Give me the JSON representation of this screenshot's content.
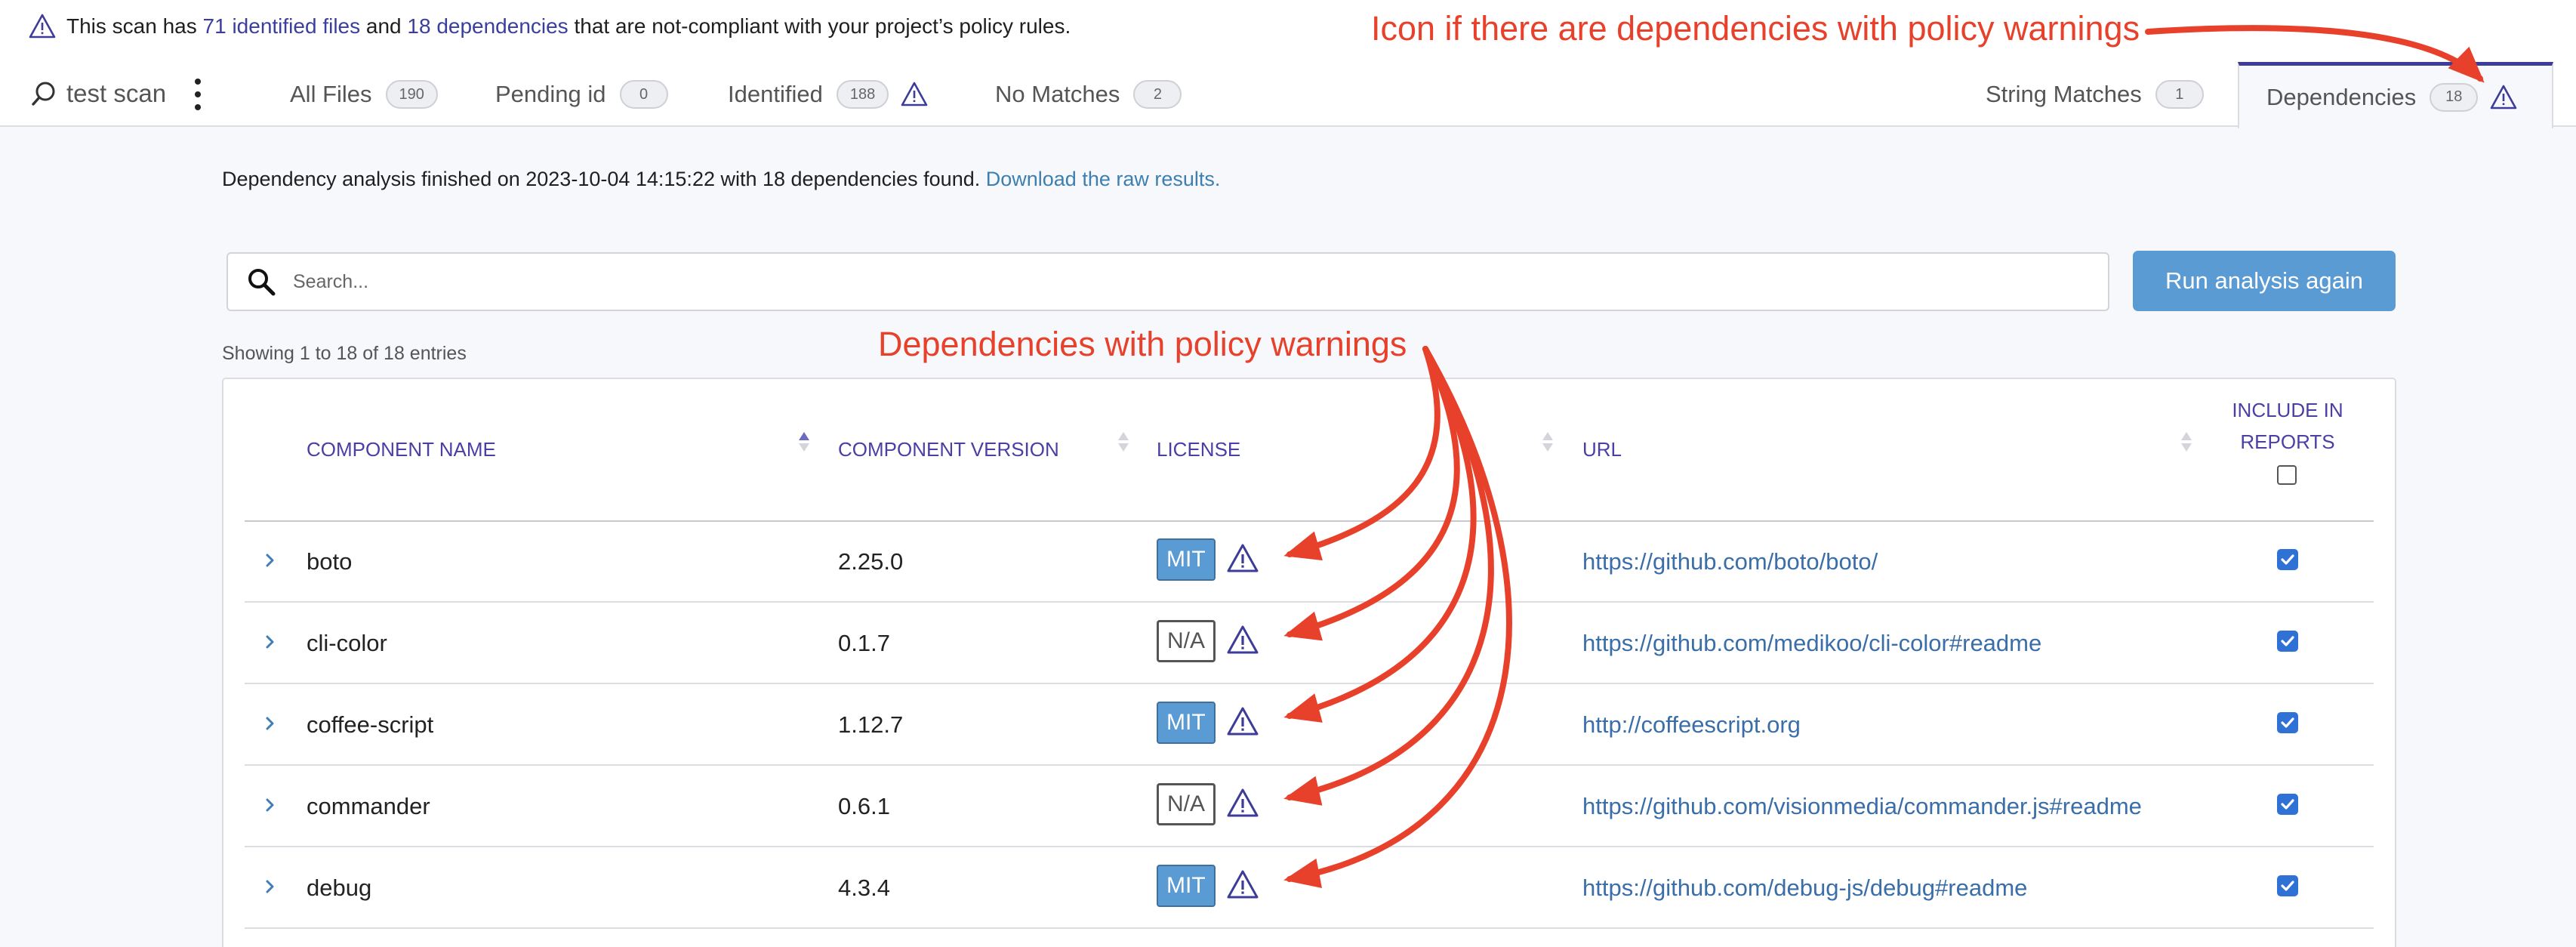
{
  "notice": {
    "prefix": "This scan has",
    "files_link": "71 identified files",
    "middle": "and",
    "deps_link": "18 dependencies",
    "suffix": "that are not-compliant with your project’s policy rules."
  },
  "scan": {
    "name": "test scan"
  },
  "tabs": [
    {
      "label": "All Files",
      "count": "190",
      "warning": false
    },
    {
      "label": "Pending id",
      "count": "0",
      "warning": false
    },
    {
      "label": "Identified",
      "count": "188",
      "warning": true
    },
    {
      "label": "No Matches",
      "count": "2",
      "warning": false
    },
    {
      "label": "String Matches",
      "count": "1",
      "warning": false
    },
    {
      "label": "Dependencies",
      "count": "18",
      "warning": true,
      "active": true
    }
  ],
  "analysis": {
    "text": "Dependency analysis finished on 2023-10-04 14:15:22 with 18 dependencies found.",
    "link": "Download the raw results."
  },
  "search": {
    "placeholder": "Search..."
  },
  "run_button": "Run analysis again",
  "showing": "Showing 1 to 18 of 18 entries",
  "table": {
    "columns": {
      "name": "COMPONENT NAME",
      "version": "COMPONENT VERSION",
      "license": "LICENSE",
      "url": "URL",
      "include_line1": "INCLUDE IN",
      "include_line2": "REPORTS"
    },
    "rows": [
      {
        "name": "boto",
        "version": "2.25.0",
        "license": "MIT",
        "license_style": "mit",
        "policy_warning": true,
        "url": "https://github.com/boto/boto/",
        "included": true
      },
      {
        "name": "cli-color",
        "version": "0.1.7",
        "license": "N/A",
        "license_style": "na",
        "policy_warning": true,
        "url": "https://github.com/medikoo/cli-color#readme",
        "included": true
      },
      {
        "name": "coffee-script",
        "version": "1.12.7",
        "license": "MIT",
        "license_style": "mit",
        "policy_warning": true,
        "url": "http://coffeescript.org",
        "included": true
      },
      {
        "name": "commander",
        "version": "0.6.1",
        "license": "N/A",
        "license_style": "na",
        "policy_warning": true,
        "url": "https://github.com/visionmedia/commander.js#readme",
        "included": true
      },
      {
        "name": "debug",
        "version": "4.3.4",
        "license": "MIT",
        "license_style": "mit",
        "policy_warning": true,
        "url": "https://github.com/debug-js/debug#readme",
        "included": true
      }
    ]
  },
  "annotations": {
    "tab_icon": "Icon if there are dependencies with policy warnings",
    "rows": "Dependencies with policy warnings"
  },
  "colors": {
    "accent": "#3d3c98",
    "annotation": "#e8412b",
    "button": "#5b9bd4",
    "link": "#3a6ea8"
  },
  "icons": {
    "warning": "warning-triangle-icon",
    "search": "search-icon",
    "expand": "chevron-right-icon",
    "menu": "kebab-menu-icon"
  }
}
